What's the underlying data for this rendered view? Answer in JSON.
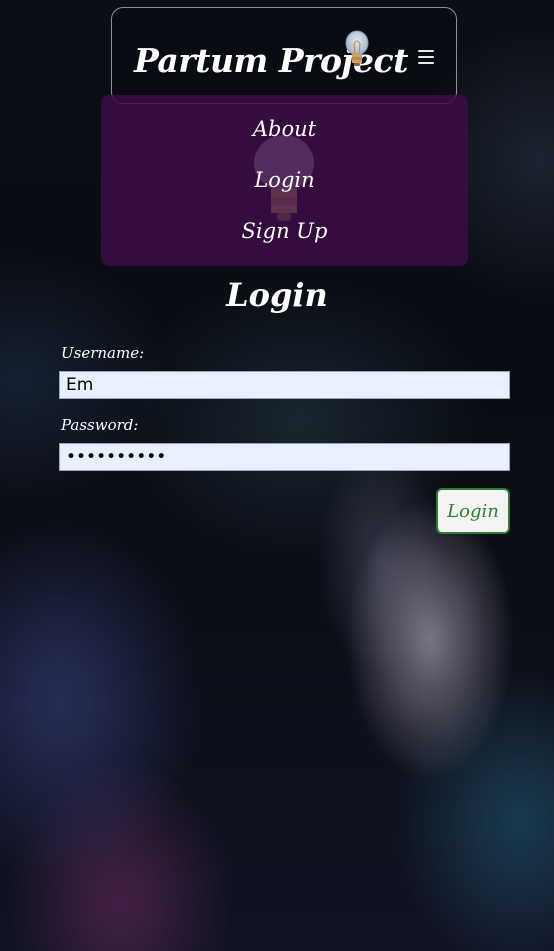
{
  "navbar": {
    "brand": "Partum Project",
    "logo_icon": "lightbulb-icon",
    "menu_icon": "hamburger-icon"
  },
  "menu": {
    "items": [
      {
        "label": "About"
      },
      {
        "label": "Login"
      },
      {
        "label": "Sign Up"
      }
    ]
  },
  "form": {
    "title": "Login",
    "username_label": "Username:",
    "username_value": "Em",
    "password_label": "Password:",
    "password_value": "••••••••••",
    "submit_label": "Login"
  },
  "colors": {
    "menu_bg": "#3c0c48",
    "submit_border": "#2e7d32",
    "input_bg": "#e8f0fe"
  }
}
